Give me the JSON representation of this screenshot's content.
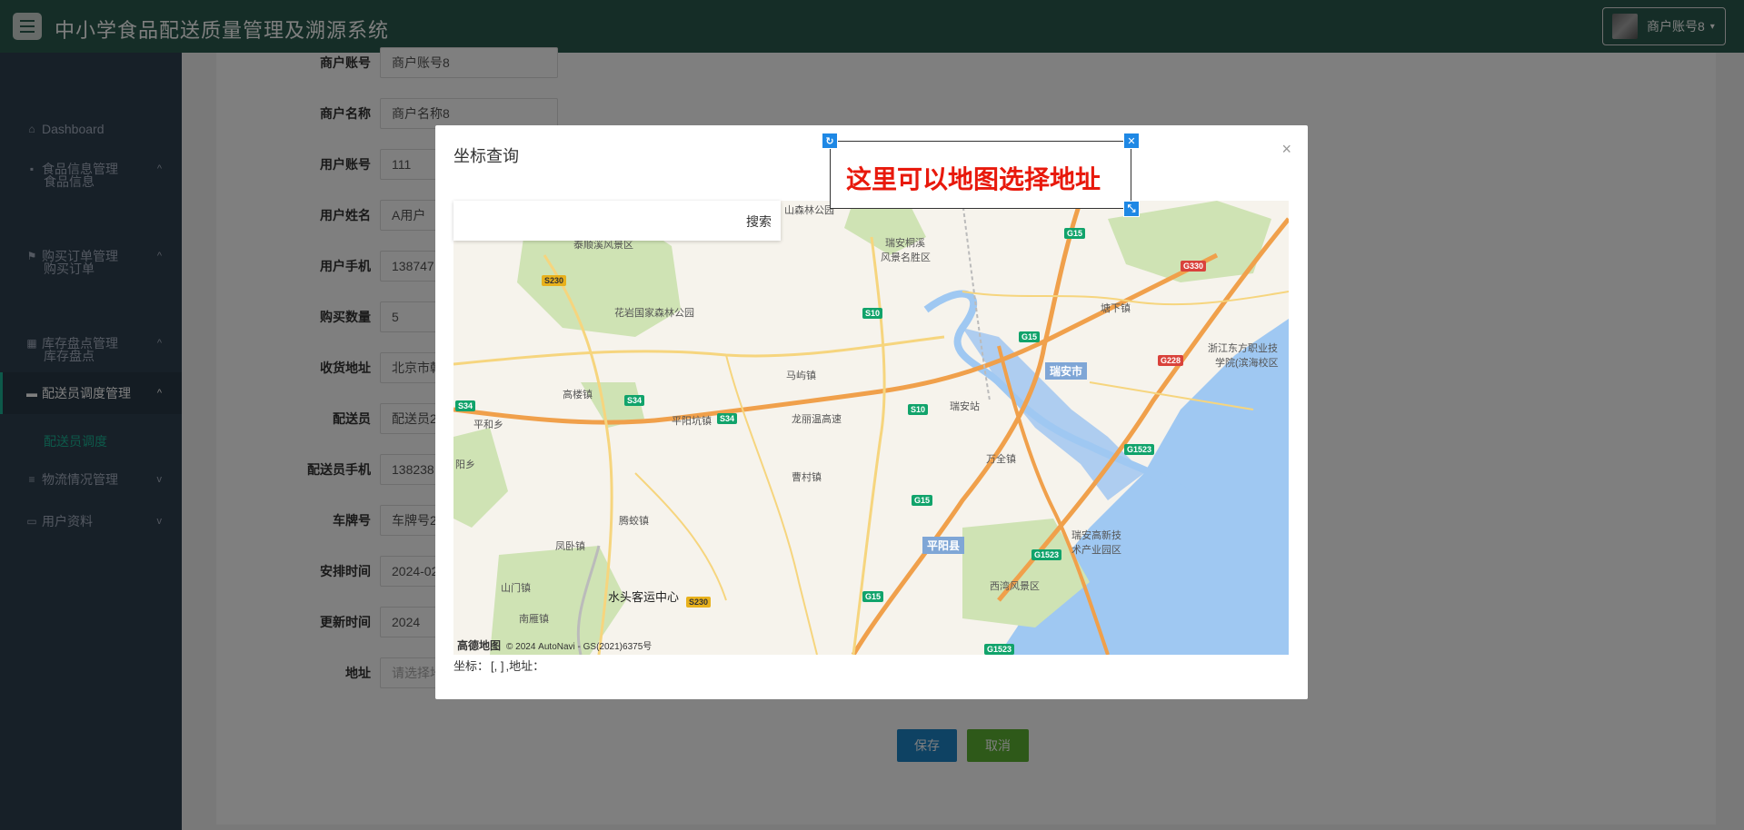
{
  "header": {
    "title": "中小学食品配送质量管理及溯源系统",
    "user_name": "商户账号8",
    "caret": "▾"
  },
  "sidebar": {
    "items": [
      {
        "label": "Dashboard",
        "icon": "home-icon"
      },
      {
        "label": "食品信息管理",
        "icon": "briefcase-icon",
        "chevron": "^"
      },
      {
        "label": "食品信息"
      },
      {
        "label": "购买订单管理",
        "icon": "flag-icon",
        "chevron": "^"
      },
      {
        "label": "购买订单"
      },
      {
        "label": "库存盘点管理",
        "icon": "grid-icon",
        "chevron": "^"
      },
      {
        "label": "库存盘点"
      },
      {
        "label": "配送员调度管理",
        "icon": "chat-icon",
        "chevron": "^"
      },
      {
        "label": "配送员调度"
      },
      {
        "label": "物流情况管理",
        "icon": "list-icon",
        "chevron": "v"
      },
      {
        "label": "用户资料",
        "icon": "card-icon",
        "chevron": "v"
      }
    ]
  },
  "form": {
    "fields": [
      {
        "label": "商户账号",
        "value": "商户账号8"
      },
      {
        "label": "商户名称",
        "value": "商户名称8"
      },
      {
        "label": "用户账号",
        "value": "111"
      },
      {
        "label": "用户姓名",
        "value": "A用户"
      },
      {
        "label": "用户手机",
        "value": "138747"
      },
      {
        "label": "购买数量",
        "value": "5"
      },
      {
        "label": "收货地址",
        "value": "北京市朝"
      },
      {
        "label": "配送员",
        "value": "配送员2"
      },
      {
        "label": "配送员手机",
        "value": "138238"
      },
      {
        "label": "车牌号",
        "value": "车牌号2"
      },
      {
        "label": "安排时间",
        "value": "2024-02"
      },
      {
        "label": "更新时间",
        "value": "2024"
      },
      {
        "label": "地址",
        "value": "请选择地"
      }
    ],
    "save_label": "保存",
    "cancel_label": "取消"
  },
  "modal": {
    "title": "坐标查询",
    "close": "×",
    "search_button": "搜索",
    "coords_label": "坐标：",
    "coords_value": "[, ]",
    "address_label": ",地址："
  },
  "annotation": {
    "text": "这里可以地图选择地址"
  },
  "map": {
    "labels": {
      "l1": "山森林公园",
      "l2": "瑞安桐溪",
      "l3": "风景名胜区",
      "l4": "花岩国家森林公园",
      "l5": "马屿镇",
      "l6": "高楼镇",
      "l7": "平和乡",
      "l8": "平阳坑镇",
      "l9": "龙丽温高速",
      "l10": "瑞安站",
      "l11": "瑞安市",
      "l12": "塘下镇",
      "l13": "浙江东方职业技",
      "l14": "学院(滨海校区",
      "l15": "阳乡",
      "l16": "万全镇",
      "l17": "曹村镇",
      "l18": "腾蛟镇",
      "l19": "凤卧镇",
      "l20": "平阳县",
      "l21": "瑞安高新技",
      "l22": "术产业园区",
      "l23": "山门镇",
      "l24": "水头客运中心",
      "l25": "南雁镇",
      "l26": "西湾风景区",
      "l27": "泰顺溪风景区"
    },
    "shields": {
      "g15a": "G15",
      "g330": "G330",
      "s230a": "S230",
      "s10a": "S10",
      "g15b": "G15",
      "g228": "G228",
      "s34a": "S34",
      "s34b": "S34",
      "s34c": "S34",
      "s10b": "S10",
      "g1523a": "G1523",
      "g15c": "G15",
      "g1523b": "G1523",
      "g15d": "G15",
      "s230b": "S230",
      "g1523c": "G1523"
    },
    "logo": "高德地图",
    "copyright": "© 2024 AutoNavi - GS(2021)6375号"
  }
}
